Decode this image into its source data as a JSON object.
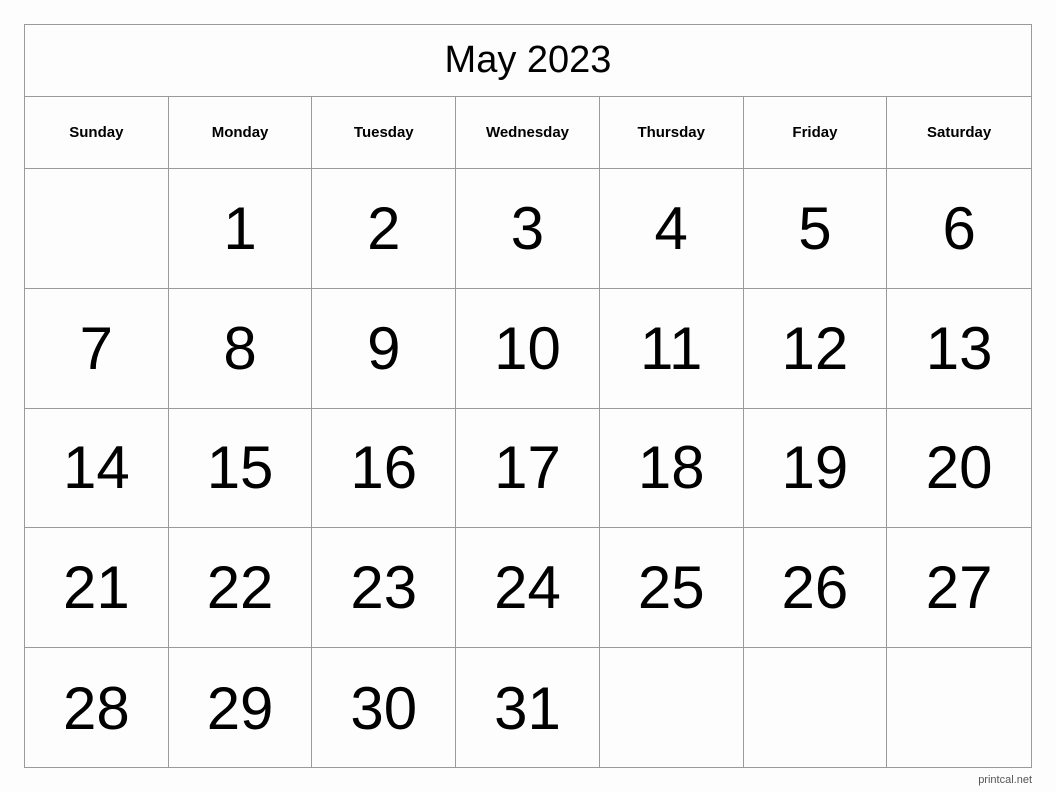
{
  "calendar": {
    "title": "May 2023",
    "weekdays": [
      "Sunday",
      "Monday",
      "Tuesday",
      "Wednesday",
      "Thursday",
      "Friday",
      "Saturday"
    ],
    "weeks": [
      [
        "",
        "1",
        "2",
        "3",
        "4",
        "5",
        "6"
      ],
      [
        "7",
        "8",
        "9",
        "10",
        "11",
        "12",
        "13"
      ],
      [
        "14",
        "15",
        "16",
        "17",
        "18",
        "19",
        "20"
      ],
      [
        "21",
        "22",
        "23",
        "24",
        "25",
        "26",
        "27"
      ],
      [
        "28",
        "29",
        "30",
        "31",
        "",
        "",
        ""
      ]
    ]
  },
  "footer": {
    "credit": "printcal.net"
  }
}
